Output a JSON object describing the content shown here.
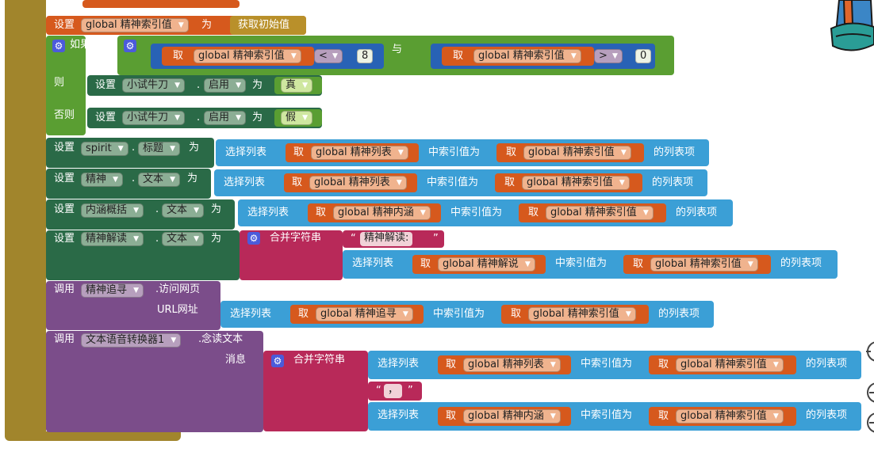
{
  "colors": {
    "olive": "#a1852c",
    "orange": "#d6591d",
    "green": "#5a9e32",
    "darkgreen": "#2a6a47",
    "blue": "#3b9fd6",
    "pink": "#b82959",
    "purple": "#7b4d8a",
    "gold": "#b9902a"
  },
  "kw": {
    "set": "设置",
    "to": "为",
    "if": "如果",
    "then": "则",
    "else": "否则",
    "and": "与",
    "get": "取",
    "pick": "选择列表",
    "at_index": "中索引值为",
    "list_item": "的列表项",
    "join": "合并字符串",
    "call": "调用",
    "msg": "消息",
    "url": "URL网址",
    "dot": "."
  },
  "ops": {
    "lt": "<",
    "gt": ">"
  },
  "vars": {
    "idx": "global 精神索引值",
    "list": "global 精神列表",
    "connote": "global 精神内涵",
    "explain": "global 精神解说",
    "trace": "global 精神追寻"
  },
  "comps": {
    "knife": "小试牛刀",
    "spirit": "spirit",
    "jingshen": "精神",
    "neihan": "内涵概括",
    "jiedu": "精神解读",
    "zhuixun": "精神追寻",
    "tts": "文本语音转换器1"
  },
  "props": {
    "enabled": "启用",
    "title": "标题",
    "text": "文本"
  },
  "blocks": {
    "init_value": "获取初始值",
    "true_val": "真",
    "false_val": "假",
    "n8": "8",
    "n0": "0",
    "str_jiedu": "精神解读:",
    "str_comma": "，",
    "visit_page": ".访问网页",
    "speak": ".念读文本"
  }
}
